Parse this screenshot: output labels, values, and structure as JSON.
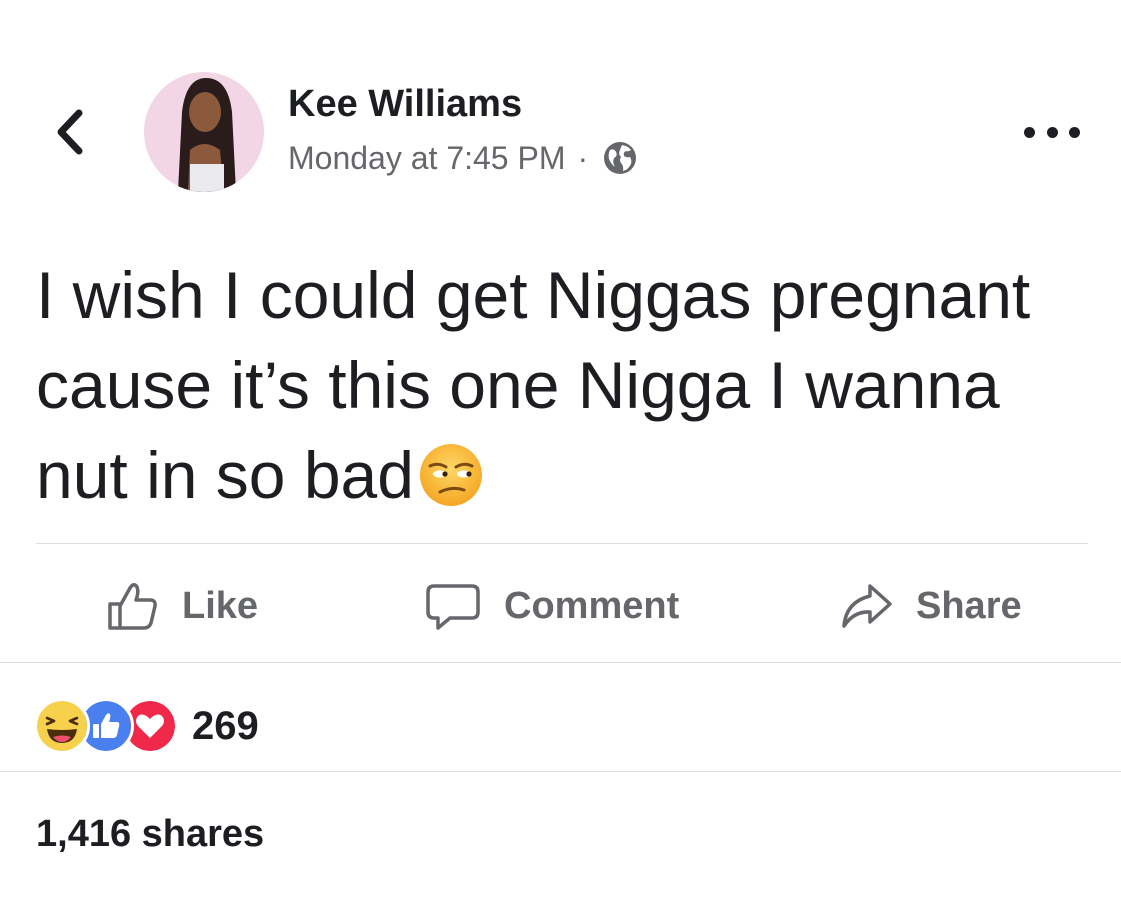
{
  "post": {
    "author": "Kee Williams",
    "timestamp": "Monday at 7:45 PM",
    "separator": "·",
    "privacy_icon": "globe-icon",
    "text": "I wish I could get Niggas pregnant cause it’s this one Nigga I wanna nut in so bad",
    "text_emoji": "unamused-face-emoji"
  },
  "header": {
    "back_icon": "chevron-left-icon",
    "more_icon": "more-horizontal-icon"
  },
  "actions": {
    "like_label": "Like",
    "comment_label": "Comment",
    "share_label": "Share"
  },
  "reactions": {
    "icons": [
      "laugh-reaction-icon",
      "like-reaction-icon",
      "love-reaction-icon"
    ],
    "count": "269"
  },
  "shares": {
    "label": "1,416 shares"
  },
  "colors": {
    "text_primary": "#1c1e21",
    "text_secondary": "#65676b",
    "divider": "#dadde1",
    "like_blue": "#4a7ff0",
    "love_red": "#f0284a",
    "haha_yellow": "#f7d14c"
  }
}
